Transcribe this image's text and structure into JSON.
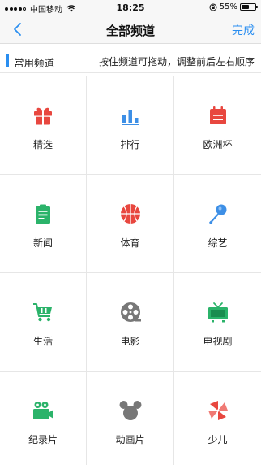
{
  "status_bar": {
    "carrier": "中国移动",
    "time": "18:25",
    "battery_percent": "55%",
    "battery_level": 0.55
  },
  "nav": {
    "title": "全部频道",
    "done_label": "完成"
  },
  "section": {
    "title": "常用频道",
    "hint": "按住频道可拖动，调整前后左右顺序"
  },
  "channels": [
    {
      "label": "精选",
      "icon": "gift-icon",
      "color": "#e8473f"
    },
    {
      "label": "排行",
      "icon": "bar-chart-icon",
      "color": "#3d8fe6"
    },
    {
      "label": "欧洲杯",
      "icon": "calendar-icon",
      "color": "#e8473f"
    },
    {
      "label": "新闻",
      "icon": "news-icon",
      "color": "#2bb36a"
    },
    {
      "label": "体育",
      "icon": "basketball-icon",
      "color": "#e8473f"
    },
    {
      "label": "综艺",
      "icon": "microphone-icon",
      "color": "#3d8fe6"
    },
    {
      "label": "生活",
      "icon": "shopping-cart-icon",
      "color": "#2bb36a"
    },
    {
      "label": "电影",
      "icon": "film-reel-icon",
      "color": "#777777"
    },
    {
      "label": "电视剧",
      "icon": "tv-icon",
      "color": "#2bb36a"
    },
    {
      "label": "纪录片",
      "icon": "video-camera-icon",
      "color": "#2bb36a"
    },
    {
      "label": "动画片",
      "icon": "cartoon-mouse-icon",
      "color": "#777777"
    },
    {
      "label": "少儿",
      "icon": "pinwheel-icon",
      "color": "#e8473f"
    }
  ]
}
